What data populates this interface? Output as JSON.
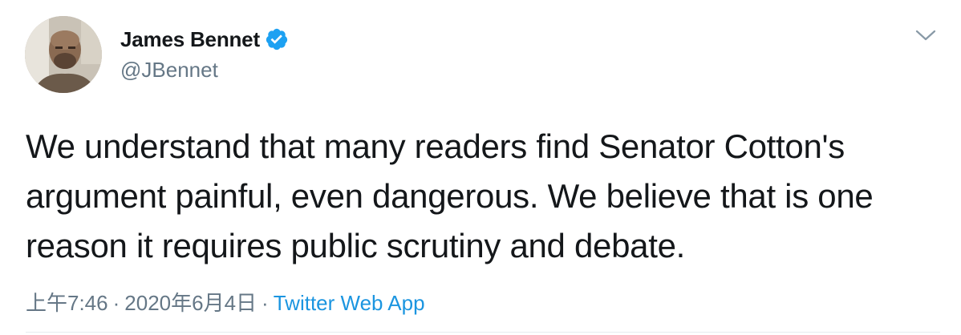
{
  "author": {
    "display_name": "James Bennet",
    "handle": "@JBennet",
    "verified": true
  },
  "tweet": {
    "text": "We understand that many readers find Senator Cotton's argument painful, even dangerous. We believe that is one reason it requires public scrutiny and debate."
  },
  "meta": {
    "time": "上午7:46",
    "separator": "·",
    "date": "2020年6月4日",
    "source": "Twitter Web App"
  },
  "colors": {
    "accent": "#1da1f2",
    "source_link": "#1b95e0",
    "secondary_text": "#657786",
    "primary_text": "#14171a"
  },
  "icons": {
    "verified": "verified-badge-icon",
    "menu": "chevron-down-icon"
  }
}
